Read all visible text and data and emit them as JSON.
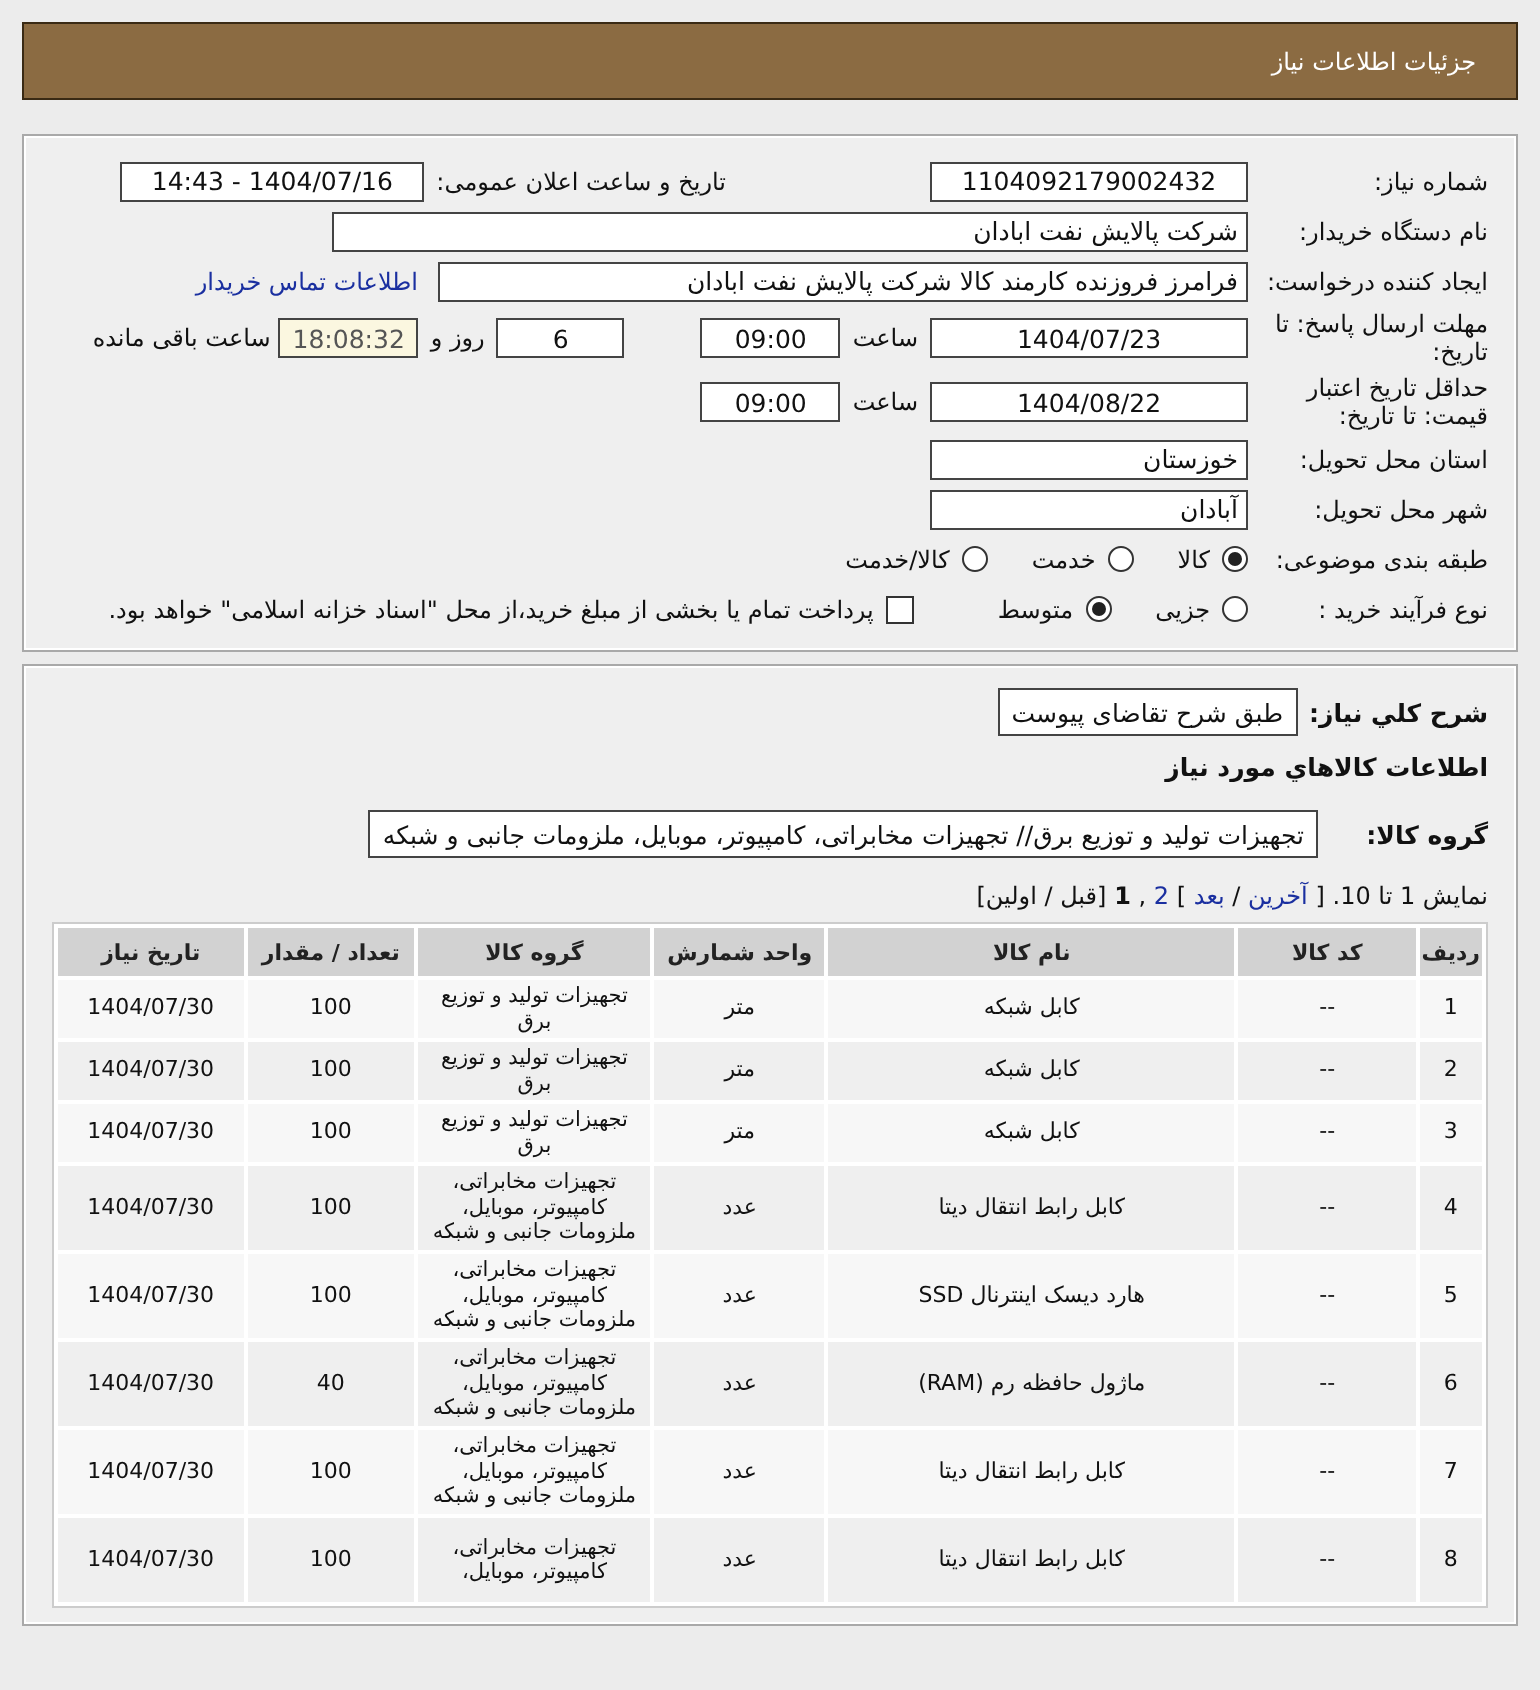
{
  "header": {
    "title": "جزئیات اطلاعات نیاز"
  },
  "details": {
    "need_number": {
      "label": "شماره نیاز:",
      "value": "1104092179002432"
    },
    "announce": {
      "label": "تاریخ و ساعت اعلان عمومی:",
      "value": "1404/07/16 - 14:43"
    },
    "buyer_org": {
      "label": "نام دستگاه خریدار:",
      "value": "شرکت پالایش نفت ابادان"
    },
    "requester": {
      "label": "ایجاد کننده درخواست:",
      "value": "فرامرز فروزنده کارمند کالا شرکت پالایش نفت ابادان",
      "link": "اطلاعات تماس خریدار"
    },
    "deadline": {
      "label": "مهلت ارسال پاسخ: تا تاریخ:",
      "date": "1404/07/23",
      "time_label": "ساعت",
      "time": "09:00",
      "days": "6",
      "days_label": "روز و",
      "remaining": "18:08:32",
      "remaining_label": "ساعت باقی مانده"
    },
    "validity": {
      "label": "حداقل تاریخ اعتبار قیمت: تا تاریخ:",
      "date": "1404/08/22",
      "time_label": "ساعت",
      "time": "09:00"
    },
    "province": {
      "label": "استان محل تحویل:",
      "value": "خوزستان"
    },
    "city": {
      "label": "شهر محل تحویل:",
      "value": "آبادان"
    },
    "category": {
      "label": "طبقه بندی موضوعی:",
      "options": [
        {
          "label": "کالا",
          "selected": true
        },
        {
          "label": "خدمت",
          "selected": false
        },
        {
          "label": "کالا/خدمت",
          "selected": false
        }
      ]
    },
    "process": {
      "label": "نوع فرآیند خرید :",
      "options": [
        {
          "label": "جزیی",
          "selected": false
        },
        {
          "label": "متوسط",
          "selected": true
        }
      ],
      "treasury": {
        "checked": false,
        "label": "پرداخت تمام یا بخشی از مبلغ خرید،از محل \"اسناد خزانه اسلامی\" خواهد بود."
      }
    }
  },
  "goods": {
    "description": {
      "label": "شرح کلي نياز:",
      "value": "طبق شرح تقاضای پیوست"
    },
    "section_title": "اطلاعات کالاهاي مورد نياز",
    "group": {
      "label": "گروه کالا:",
      "value": "تجهیزات تولید و توزیع برق// تجهیزات مخابراتی، کامپیوتر، موبایل، ملزومات جانبی و شبکه"
    },
    "pagination": {
      "summary": "نمایش 1 تا 10.",
      "parts": [
        {
          "kind": "text",
          "text": "["
        },
        {
          "kind": "link",
          "text": "آخرین"
        },
        {
          "kind": "text",
          "text": "/"
        },
        {
          "kind": "link",
          "text": "بعد"
        },
        {
          "kind": "text",
          "text": "]"
        },
        {
          "kind": "link",
          "text": "2"
        },
        {
          "kind": "text",
          "text": ","
        },
        {
          "kind": "current",
          "text": "1"
        },
        {
          "kind": "text",
          "text": "[قبل / اولین]"
        }
      ]
    },
    "table": {
      "columns": [
        "ردیف",
        "کد کالا",
        "نام کالا",
        "واحد شمارش",
        "گروه کالا",
        "تعداد / مقدار",
        "تاریخ نیاز"
      ],
      "rows": [
        [
          "1",
          "--",
          "کابل شبکه",
          "متر",
          "تجهیزات تولید و توزیع برق",
          "100",
          "1404/07/30"
        ],
        [
          "2",
          "--",
          "کابل شبکه",
          "متر",
          "تجهیزات تولید و توزیع برق",
          "100",
          "1404/07/30"
        ],
        [
          "3",
          "--",
          "کابل شبکه",
          "متر",
          "تجهیزات تولید و توزیع برق",
          "100",
          "1404/07/30"
        ],
        [
          "4",
          "--",
          "کابل رابط انتقال دیتا",
          "عدد",
          "تجهیزات مخابراتی، کامپیوتر، موبایل، ملزومات جانبی و شبکه",
          "100",
          "1404/07/30"
        ],
        [
          "5",
          "--",
          "هارد دیسک اینترنال SSD",
          "عدد",
          "تجهیزات مخابراتی، کامپیوتر، موبایل، ملزومات جانبی و شبکه",
          "100",
          "1404/07/30"
        ],
        [
          "6",
          "--",
          "ماژول حافظه رم (RAM)",
          "عدد",
          "تجهیزات مخابراتی، کامپیوتر، موبایل، ملزومات جانبی و شبکه",
          "40",
          "1404/07/30"
        ],
        [
          "7",
          "--",
          "کابل رابط انتقال دیتا",
          "عدد",
          "تجهیزات مخابراتی، کامپیوتر، موبایل، ملزومات جانبی و شبکه",
          "100",
          "1404/07/30"
        ],
        [
          "8",
          "--",
          "کابل رابط انتقال دیتا",
          "عدد",
          "تجهیزات مخابراتی، کامپیوتر، موبایل،",
          "100",
          "1404/07/30"
        ]
      ]
    }
  }
}
